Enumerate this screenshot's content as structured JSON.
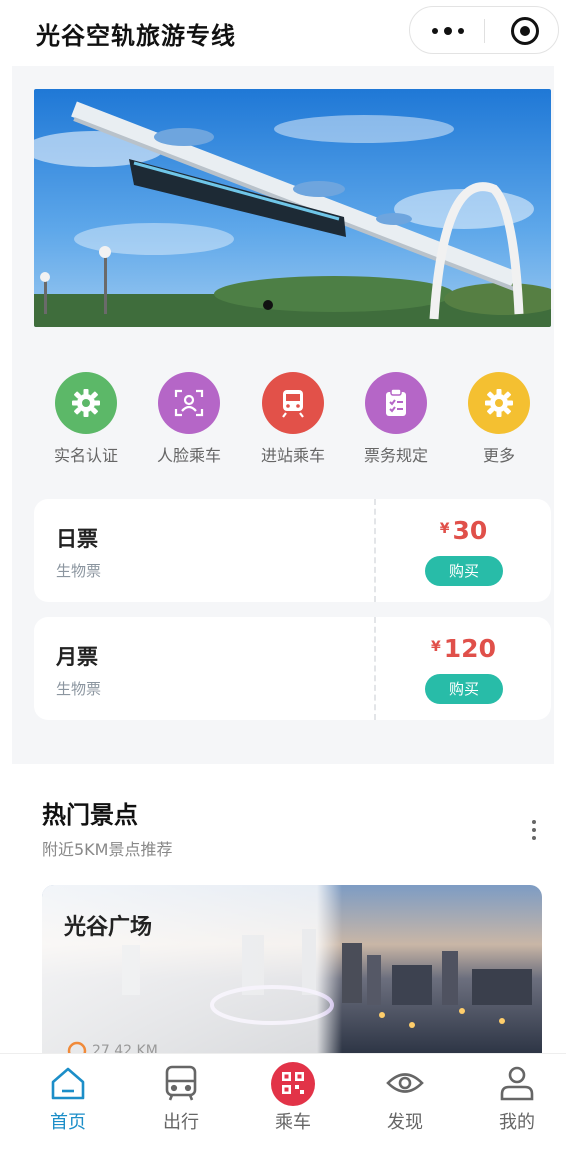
{
  "app": {
    "title": "光谷空轨旅游专线"
  },
  "colors": {
    "accent": "#1c8ec8",
    "price": "#e0504a",
    "buy_button": "#28bca8",
    "panel_bg": "#f5f6f8"
  },
  "quick_actions": [
    {
      "label": "实名认证",
      "icon": "gear-icon",
      "color": "#5cb868"
    },
    {
      "label": "人脸乘车",
      "icon": "face-scan-icon",
      "color": "#b566c7"
    },
    {
      "label": "进站乘车",
      "icon": "train-icon",
      "color": "#e25149"
    },
    {
      "label": "票务规定",
      "icon": "clipboard-icon",
      "color": "#b566c7"
    },
    {
      "label": "更多",
      "icon": "gear-icon",
      "color": "#f4c031"
    }
  ],
  "tickets": [
    {
      "name": "日票",
      "type": "生物票",
      "currency": "¥",
      "price": "30",
      "buy_label": "购买"
    },
    {
      "name": "月票",
      "type": "生物票",
      "currency": "¥",
      "price": "120",
      "buy_label": "购买"
    }
  ],
  "attractions": {
    "title": "热门景点",
    "subtitle": "附近5KM景点推荐",
    "items": [
      {
        "name": "光谷广场",
        "distance": "27.42 KM"
      }
    ]
  },
  "tabbar": [
    {
      "label": "首页",
      "icon": "home-icon",
      "active": true
    },
    {
      "label": "出行",
      "icon": "bus-icon",
      "active": false
    },
    {
      "label": "乘车",
      "icon": "qr-code-icon",
      "active": false
    },
    {
      "label": "发现",
      "icon": "eye-icon",
      "active": false
    },
    {
      "label": "我的",
      "icon": "user-icon",
      "active": false
    }
  ]
}
